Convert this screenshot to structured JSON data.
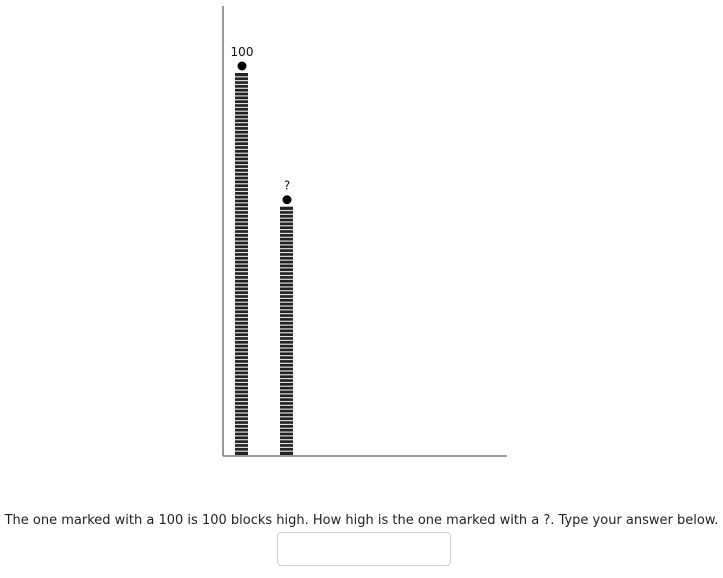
{
  "chart_data": {
    "type": "bar",
    "categories": [
      "100",
      "?"
    ],
    "values": [
      100,
      65
    ],
    "title": "",
    "xlabel": "",
    "ylabel": "",
    "ylim": [
      0,
      100
    ],
    "bar_labels": [
      "100",
      "?"
    ],
    "bar_style": "stacked blocks"
  },
  "question": {
    "text": "The one marked with a 100 is 100 blocks high. How high is the one marked with a ?. Type your answer below."
  },
  "answer": {
    "value": "",
    "placeholder": ""
  },
  "colors": {
    "bar": "#222222",
    "axis": "#777777",
    "marker": "#000000"
  }
}
